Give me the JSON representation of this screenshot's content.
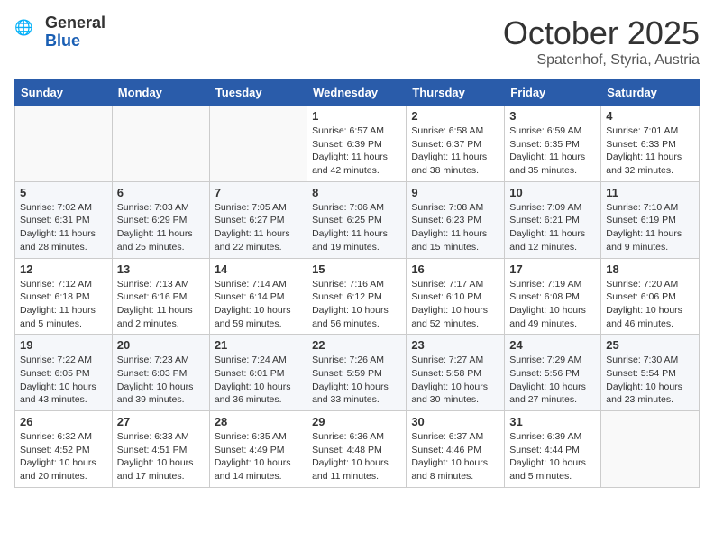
{
  "header": {
    "logo_general": "General",
    "logo_blue": "Blue",
    "month": "October 2025",
    "location": "Spatenhof, Styria, Austria"
  },
  "days_of_week": [
    "Sunday",
    "Monday",
    "Tuesday",
    "Wednesday",
    "Thursday",
    "Friday",
    "Saturday"
  ],
  "weeks": [
    [
      {
        "day": "",
        "info": ""
      },
      {
        "day": "",
        "info": ""
      },
      {
        "day": "",
        "info": ""
      },
      {
        "day": "1",
        "info": "Sunrise: 6:57 AM\nSunset: 6:39 PM\nDaylight: 11 hours and 42 minutes."
      },
      {
        "day": "2",
        "info": "Sunrise: 6:58 AM\nSunset: 6:37 PM\nDaylight: 11 hours and 38 minutes."
      },
      {
        "day": "3",
        "info": "Sunrise: 6:59 AM\nSunset: 6:35 PM\nDaylight: 11 hours and 35 minutes."
      },
      {
        "day": "4",
        "info": "Sunrise: 7:01 AM\nSunset: 6:33 PM\nDaylight: 11 hours and 32 minutes."
      }
    ],
    [
      {
        "day": "5",
        "info": "Sunrise: 7:02 AM\nSunset: 6:31 PM\nDaylight: 11 hours and 28 minutes."
      },
      {
        "day": "6",
        "info": "Sunrise: 7:03 AM\nSunset: 6:29 PM\nDaylight: 11 hours and 25 minutes."
      },
      {
        "day": "7",
        "info": "Sunrise: 7:05 AM\nSunset: 6:27 PM\nDaylight: 11 hours and 22 minutes."
      },
      {
        "day": "8",
        "info": "Sunrise: 7:06 AM\nSunset: 6:25 PM\nDaylight: 11 hours and 19 minutes."
      },
      {
        "day": "9",
        "info": "Sunrise: 7:08 AM\nSunset: 6:23 PM\nDaylight: 11 hours and 15 minutes."
      },
      {
        "day": "10",
        "info": "Sunrise: 7:09 AM\nSunset: 6:21 PM\nDaylight: 11 hours and 12 minutes."
      },
      {
        "day": "11",
        "info": "Sunrise: 7:10 AM\nSunset: 6:19 PM\nDaylight: 11 hours and 9 minutes."
      }
    ],
    [
      {
        "day": "12",
        "info": "Sunrise: 7:12 AM\nSunset: 6:18 PM\nDaylight: 11 hours and 5 minutes."
      },
      {
        "day": "13",
        "info": "Sunrise: 7:13 AM\nSunset: 6:16 PM\nDaylight: 11 hours and 2 minutes."
      },
      {
        "day": "14",
        "info": "Sunrise: 7:14 AM\nSunset: 6:14 PM\nDaylight: 10 hours and 59 minutes."
      },
      {
        "day": "15",
        "info": "Sunrise: 7:16 AM\nSunset: 6:12 PM\nDaylight: 10 hours and 56 minutes."
      },
      {
        "day": "16",
        "info": "Sunrise: 7:17 AM\nSunset: 6:10 PM\nDaylight: 10 hours and 52 minutes."
      },
      {
        "day": "17",
        "info": "Sunrise: 7:19 AM\nSunset: 6:08 PM\nDaylight: 10 hours and 49 minutes."
      },
      {
        "day": "18",
        "info": "Sunrise: 7:20 AM\nSunset: 6:06 PM\nDaylight: 10 hours and 46 minutes."
      }
    ],
    [
      {
        "day": "19",
        "info": "Sunrise: 7:22 AM\nSunset: 6:05 PM\nDaylight: 10 hours and 43 minutes."
      },
      {
        "day": "20",
        "info": "Sunrise: 7:23 AM\nSunset: 6:03 PM\nDaylight: 10 hours and 39 minutes."
      },
      {
        "day": "21",
        "info": "Sunrise: 7:24 AM\nSunset: 6:01 PM\nDaylight: 10 hours and 36 minutes."
      },
      {
        "day": "22",
        "info": "Sunrise: 7:26 AM\nSunset: 5:59 PM\nDaylight: 10 hours and 33 minutes."
      },
      {
        "day": "23",
        "info": "Sunrise: 7:27 AM\nSunset: 5:58 PM\nDaylight: 10 hours and 30 minutes."
      },
      {
        "day": "24",
        "info": "Sunrise: 7:29 AM\nSunset: 5:56 PM\nDaylight: 10 hours and 27 minutes."
      },
      {
        "day": "25",
        "info": "Sunrise: 7:30 AM\nSunset: 5:54 PM\nDaylight: 10 hours and 23 minutes."
      }
    ],
    [
      {
        "day": "26",
        "info": "Sunrise: 6:32 AM\nSunset: 4:52 PM\nDaylight: 10 hours and 20 minutes."
      },
      {
        "day": "27",
        "info": "Sunrise: 6:33 AM\nSunset: 4:51 PM\nDaylight: 10 hours and 17 minutes."
      },
      {
        "day": "28",
        "info": "Sunrise: 6:35 AM\nSunset: 4:49 PM\nDaylight: 10 hours and 14 minutes."
      },
      {
        "day": "29",
        "info": "Sunrise: 6:36 AM\nSunset: 4:48 PM\nDaylight: 10 hours and 11 minutes."
      },
      {
        "day": "30",
        "info": "Sunrise: 6:37 AM\nSunset: 4:46 PM\nDaylight: 10 hours and 8 minutes."
      },
      {
        "day": "31",
        "info": "Sunrise: 6:39 AM\nSunset: 4:44 PM\nDaylight: 10 hours and 5 minutes."
      },
      {
        "day": "",
        "info": ""
      }
    ]
  ]
}
